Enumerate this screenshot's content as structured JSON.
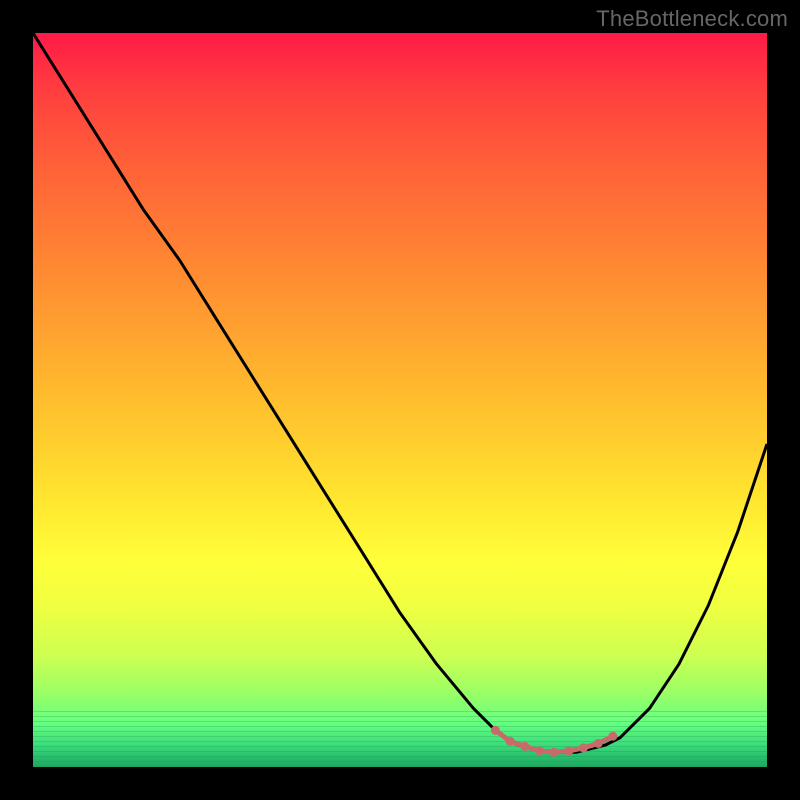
{
  "watermark": "TheBottleneck.com",
  "chart_data": {
    "type": "line",
    "title": "",
    "xlabel": "",
    "ylabel": "",
    "xlim": [
      0,
      100
    ],
    "ylim": [
      0,
      100
    ],
    "grid": false,
    "legend": false,
    "series": [
      {
        "name": "bottleneck-curve",
        "x": [
          0,
          5,
          10,
          15,
          20,
          25,
          30,
          35,
          40,
          45,
          50,
          55,
          60,
          63,
          66,
          70,
          74,
          78,
          80,
          84,
          88,
          92,
          96,
          100
        ],
        "y": [
          100,
          92,
          84,
          76,
          69,
          61,
          53,
          45,
          37,
          29,
          21,
          14,
          8,
          5,
          3,
          2,
          2,
          3,
          4,
          8,
          14,
          22,
          32,
          44
        ]
      }
    ],
    "markers": {
      "name": "optimal-range",
      "x": [
        63,
        65,
        67,
        69,
        71,
        73,
        75,
        77,
        79
      ],
      "y": [
        5,
        3.5,
        2.8,
        2.2,
        2,
        2.2,
        2.6,
        3.2,
        4.2
      ]
    },
    "colors": {
      "curve": "#000000",
      "marker": "#c96a6a",
      "gradient_top": "#ff1a47",
      "gradient_bottom": "#1fa862"
    }
  }
}
